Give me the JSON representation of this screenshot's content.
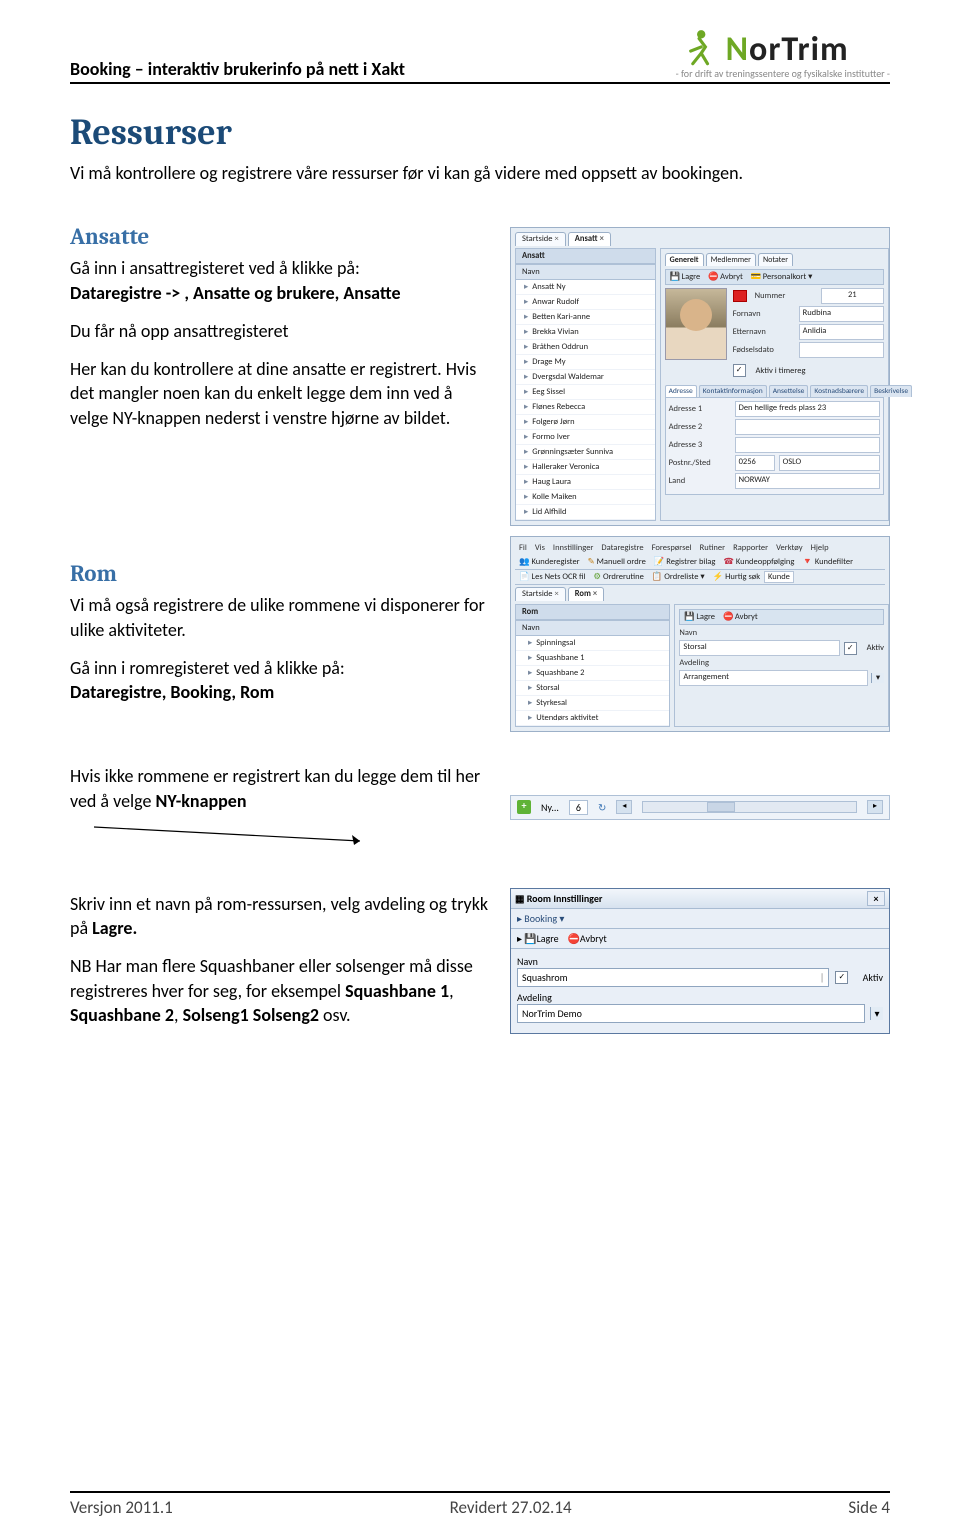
{
  "header": {
    "title": "Booking – interaktiv brukerinfo på nett i Xakt",
    "logo_main": "N",
    "logo_rest": "orTrim",
    "logo_sub": "- for drift av treningssentere og fysikalske institutter -"
  },
  "h_ressurser": "Ressurser",
  "p_ressurser": "Vi må kontrollere og registrere våre ressurser før vi kan gå videre med oppsett av bookingen.",
  "h_ansatte": "Ansatte",
  "p_ansatte_1a": "Gå inn i ansattregisteret ved å klikke på:",
  "p_ansatte_1b": "Dataregistre -> , Ansatte og brukere, Ansatte",
  "p_ansatte_2": "Du får nå opp ansattregisteret",
  "p_ansatte_3": "Her kan du kontrollere at dine ansatte er registrert. Hvis det mangler noen kan du enkelt legge dem inn ved å velge NY-knappen nederst i venstre hjørne av bildet.",
  "h_rom": "Rom",
  "p_rom_1": "Vi må også registrere de ulike rommene vi disponerer for ulike aktiviteter.",
  "p_rom_2a": "Gå inn i romregisteret ved å klikke på:",
  "p_rom_2b": "Dataregistre, Booking, Rom",
  "p_ny_1": "Hvis ikke rommene er registrert kan du legge dem til her ved å velge ",
  "p_ny_bold": "NY-knappen",
  "p_lagre_1": "Skriv inn et navn på rom-ressursen, velg avdeling og trykk på ",
  "p_lagre_bold": "Lagre.",
  "p_squash": "NB Har man flere Squashbaner eller solsenger må disse registreres hver for seg, for eksempel ",
  "p_squash_b1": "Squashbane 1",
  "p_squash_mid": ", ",
  "p_squash_b2": "Squashbane 2",
  "p_squash_mid2": ", ",
  "p_squash_b3": "Solseng1 Solseng2",
  "p_squash_tail": "   osv.",
  "mock1": {
    "tab_start": "Startside",
    "tab_ansatt": "Ansatt",
    "pane_title": "Ansatt",
    "col_navn": "Navn",
    "btn_lagre": "Lagre",
    "btn_avbryt": "Avbryt",
    "btn_personkort": "Personalkort",
    "subtab_generelt": "Generelt",
    "subtab_medlemmer": "Medlemmer",
    "subtab_notater": "Notater",
    "lbl_nummer": "Nummer",
    "val_nummer": "21",
    "lbl_fornavn": "Fornavn",
    "val_fornavn": "Rudbina",
    "lbl_etternavn": "Etternavn",
    "val_etternavn": "Anlidia",
    "lbl_fodsel": "Fødselsdato",
    "chk_aktiv_t": "Aktiv i timereg",
    "names": [
      "Ansatt Ny",
      "Anwar Rudolf",
      "Betten Kari-anne",
      "Brekka Vivian",
      "Bråthen Oddrun",
      "Drage My",
      "Dvergsdal Waldemar",
      "Eeg Sissel",
      "Flønes Rebecca",
      "Folgerø Jørn",
      "Formo Iver",
      "Grønningsæter Sunniva",
      "Halleraker Veronica",
      "Haug Laura",
      "Kolle Maiken",
      "Lid Alfhild"
    ],
    "addr_tabs": [
      "Adresse",
      "Kontaktinformasjon",
      "Ansettelse",
      "Kostnadsbærere",
      "Beskrivelse"
    ],
    "lbl_a1": "Adresse 1",
    "val_a1": "Den hellige freds plass 23",
    "lbl_a2": "Adresse 2",
    "lbl_a3": "Adresse 3",
    "lbl_post": "Postnr./Sted",
    "val_postnr": "0256",
    "val_sted": "OSLO",
    "lbl_land": "Land",
    "val_land": "NORWAY"
  },
  "mock2": {
    "menu": [
      "Fil",
      "Vis",
      "Innstillinger",
      "Dataregistre",
      "Forespørsel",
      "Rutiner",
      "Rapporter",
      "Verktøy",
      "Hjelp"
    ],
    "cmds_row1": [
      "Kunderegister",
      "Manuell ordre",
      "Registrer bilag",
      "Kundeoppfølging",
      "Kundefilter"
    ],
    "cmds_row2_a": "Les Nets OCR fil",
    "cmds_row2_b": "Ordrerutine",
    "cmds_row2_c": "Ordreliste",
    "cmds_row2_hs": "Hurtig søk",
    "cmds_row2_hsv": "Kunde",
    "tab_start": "Startside",
    "tab_rom": "Rom",
    "pane_title": "Rom",
    "col_navn": "Navn",
    "btn_lagre": "Lagre",
    "btn_avbryt": "Avbryt",
    "rooms": [
      "Spinningsal",
      "Squashbane 1",
      "Squashbane 2",
      "Storsal",
      "Styrkesal",
      "Utendørs aktivitet"
    ],
    "lbl_navn": "Navn",
    "val_navn": "Storsal",
    "chk_aktiv": "Aktiv",
    "lbl_avd": "Avdeling",
    "val_avd": "Arrangement"
  },
  "mock3": {
    "ny_label": "Ny...",
    "count": "6",
    "refresh": "↻"
  },
  "mock4": {
    "title": "Room Innstillinger",
    "bc1": "Booking",
    "btn_lagre": "Lagre",
    "btn_avbryt": "Avbryt",
    "lbl_navn": "Navn",
    "val_navn": "Squashrom",
    "chk_aktiv": "Aktiv",
    "lbl_avd": "Avdeling",
    "val_avd": "NorTrim Demo"
  },
  "footer": {
    "left": "Versjon 2011.1",
    "center": "Revidert 27.02.14",
    "right": "Side 4"
  }
}
